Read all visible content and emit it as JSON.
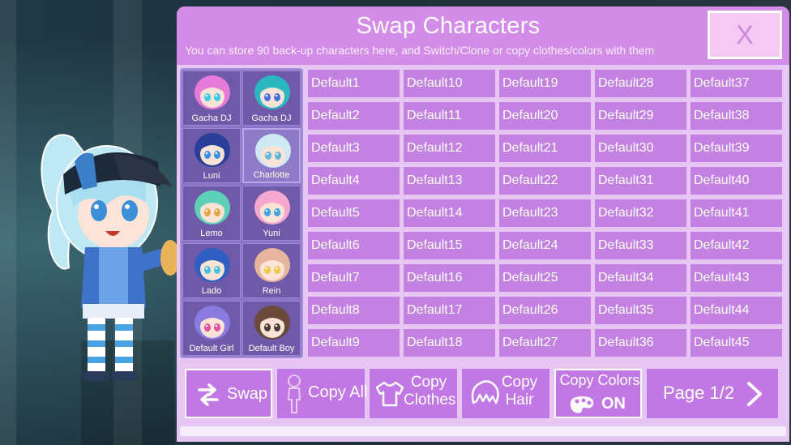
{
  "header": {
    "title": "Swap Characters",
    "subtitle": "You can store 90 back-up characters here, and Switch/Clone or copy clothes/colors with them",
    "close_label": "X"
  },
  "presets": [
    {
      "name": "Gacha DJ",
      "hair": "#e67ad8",
      "eyes": "#3ec9e8",
      "skin": "#fbe3d6"
    },
    {
      "name": "Gacha DJ",
      "hair": "#2cb7c0",
      "eyes": "#4b6de0",
      "skin": "#fbe3d6"
    },
    {
      "name": "Luni",
      "hair": "#2a3f9a",
      "eyes": "#3a8fe8",
      "skin": "#fbe3d6"
    },
    {
      "name": "Charlotte",
      "hair": "#cfe9f2",
      "eyes": "#5fb7d8",
      "skin": "#fbe3d6"
    },
    {
      "name": "Lemo",
      "hair": "#5fd0b8",
      "eyes": "#e3a34a",
      "skin": "#fbe3d6"
    },
    {
      "name": "Yuni",
      "hair": "#f5a8cf",
      "eyes": "#3aa0e0",
      "skin": "#fbe3d6"
    },
    {
      "name": "Lado",
      "hair": "#2f5fc0",
      "eyes": "#49c2e0",
      "skin": "#fbe3d6"
    },
    {
      "name": "Rein",
      "hair": "#e7b59e",
      "eyes": "#f2c84a",
      "skin": "#fbe3d6"
    },
    {
      "name": "Default Girl",
      "hair": "#8a7be0",
      "eyes": "#e54fa2",
      "skin": "#fbe3d6"
    },
    {
      "name": "Default Boy",
      "hair": "#6a4a3a",
      "eyes": "#4a3a30",
      "skin": "#fbe3d6"
    }
  ],
  "selected_preset": 3,
  "slots": [
    "Default1",
    "Default2",
    "Default3",
    "Default4",
    "Default5",
    "Default6",
    "Default7",
    "Default8",
    "Default9",
    "Default10",
    "Default11",
    "Default12",
    "Default13",
    "Default14",
    "Default15",
    "Default16",
    "Default17",
    "Default18",
    "Default19",
    "Default20",
    "Default21",
    "Default22",
    "Default23",
    "Default24",
    "Default25",
    "Default26",
    "Default27",
    "Default28",
    "Default29",
    "Default30",
    "Default31",
    "Default32",
    "Default33",
    "Default34",
    "Default35",
    "Default36",
    "Default37",
    "Default38",
    "Default39",
    "Default40",
    "Default41",
    "Default42",
    "Default43",
    "Default44",
    "Default45"
  ],
  "buttons": {
    "swap": "Swap",
    "copy_all": "Copy All",
    "copy_clothes_1": "Copy",
    "copy_clothes_2": "Clothes",
    "copy_hair_1": "Copy",
    "copy_hair_2": "Hair",
    "copy_colors": "Copy Colors",
    "copy_colors_state": "ON",
    "page": "Page 1/2"
  },
  "colors": {
    "panel": "#e7c6f3",
    "header": "#d38ce8",
    "slot": "#c381e2",
    "preset_bg": "#6f5aaa",
    "button": "#c178e4"
  }
}
